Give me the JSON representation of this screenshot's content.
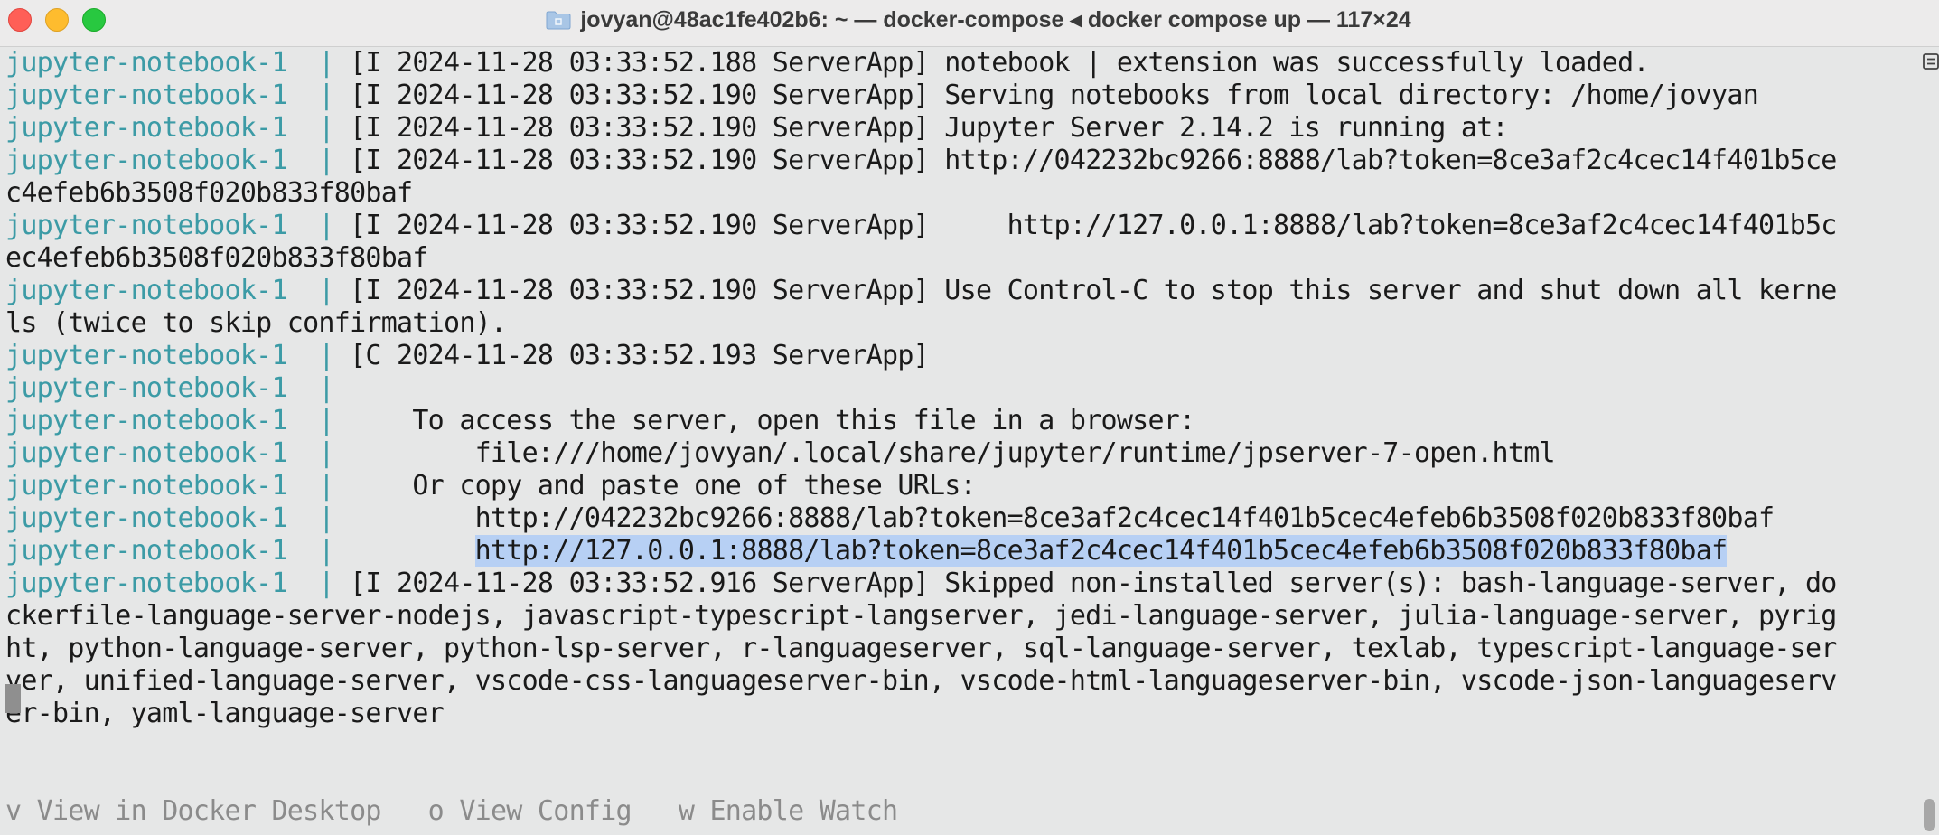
{
  "window": {
    "title": "jovyan@48ac1fe402b6: ~ — docker-compose ◂ docker compose up — 117×24",
    "traffic_lights": {
      "close_glyph": "×",
      "minimize_glyph": "−",
      "zoom_glyph": "+"
    },
    "title_icon": "folder-icon",
    "colors": {
      "close": "#ff5f57",
      "minimize": "#febc2e",
      "zoom": "#28c840",
      "background": "#e6e7e7",
      "prefix_teal": "#3c9ba6",
      "selection": "#b7d0f4"
    }
  },
  "terminal": {
    "lines": [
      {
        "prefix": "jupyter-notebook-1  | ",
        "text": "[I 2024-11-28 03:33:52.188 ServerApp] notebook | extension was successfully loaded."
      },
      {
        "prefix": "jupyter-notebook-1  | ",
        "text": "[I 2024-11-28 03:33:52.190 ServerApp] Serving notebooks from local directory: /home/jovyan"
      },
      {
        "prefix": "jupyter-notebook-1  | ",
        "text": "[I 2024-11-28 03:33:52.190 ServerApp] Jupyter Server 2.14.2 is running at:"
      },
      {
        "prefix": "jupyter-notebook-1  | ",
        "text": "[I 2024-11-28 03:33:52.190 ServerApp] http://042232bc9266:8888/lab?token=8ce3af2c4cec14f401b5ce"
      },
      {
        "prefix": "",
        "text": "c4efeb6b3508f020b833f80baf"
      },
      {
        "prefix": "jupyter-notebook-1  | ",
        "text": "[I 2024-11-28 03:33:52.190 ServerApp]     http://127.0.0.1:8888/lab?token=8ce3af2c4cec14f401b5c"
      },
      {
        "prefix": "",
        "text": "ec4efeb6b3508f020b833f80baf"
      },
      {
        "prefix": "jupyter-notebook-1  | ",
        "text": "[I 2024-11-28 03:33:52.190 ServerApp] Use Control-C to stop this server and shut down all kerne"
      },
      {
        "prefix": "",
        "text": "ls (twice to skip confirmation)."
      },
      {
        "prefix": "jupyter-notebook-1  | ",
        "text": "[C 2024-11-28 03:33:52.193 ServerApp]"
      },
      {
        "prefix": "jupyter-notebook-1  | ",
        "text": ""
      },
      {
        "prefix": "jupyter-notebook-1  | ",
        "text": "    To access the server, open this file in a browser:"
      },
      {
        "prefix": "jupyter-notebook-1  | ",
        "text": "        file:///home/jovyan/.local/share/jupyter/runtime/jpserver-7-open.html"
      },
      {
        "prefix": "jupyter-notebook-1  | ",
        "text": "    Or copy and paste one of these URLs:"
      },
      {
        "prefix": "jupyter-notebook-1  | ",
        "text": "        http://042232bc9266:8888/lab?token=8ce3af2c4cec14f401b5cec4efeb6b3508f020b833f80baf"
      },
      {
        "prefix": "jupyter-notebook-1  | ",
        "text_before": "        ",
        "selected": "http://127.0.0.1:8888/lab?token=8ce3af2c4cec14f401b5cec4efeb6b3508f020b833f80baf"
      },
      {
        "prefix": "jupyter-notebook-1  | ",
        "text": "[I 2024-11-28 03:33:52.916 ServerApp] Skipped non-installed server(s): bash-language-server, do"
      },
      {
        "prefix": "",
        "text": "ckerfile-language-server-nodejs, javascript-typescript-langserver, jedi-language-server, julia-language-server, pyrig"
      },
      {
        "prefix": "",
        "text": "ht, python-language-server, python-lsp-server, r-languageserver, sql-language-server, texlab, typescript-language-ser"
      },
      {
        "prefix": "",
        "text": "ver, unified-language-server, vscode-css-languageserver-bin, vscode-html-languageserver-bin, vscode-json-languageserv"
      },
      {
        "prefix": "",
        "text": "er-bin, yaml-language-server"
      }
    ],
    "footer_hint": "v View in Docker Desktop   o View Config   w Enable Watch"
  },
  "scrollbar": {
    "marker_icon": "scroll-marker-icon"
  }
}
